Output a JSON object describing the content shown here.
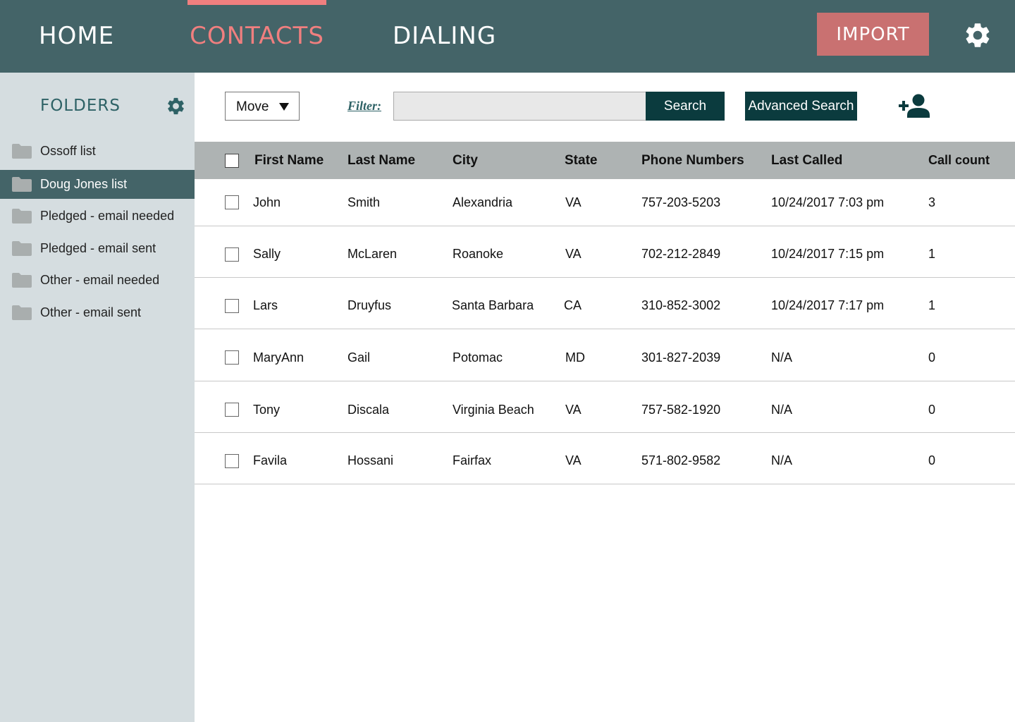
{
  "nav": {
    "tabs": [
      {
        "label": "HOME"
      },
      {
        "label": "CONTACTS"
      },
      {
        "label": "DIALING"
      }
    ],
    "active_tab": "CONTACTS",
    "import_label": "IMPORT",
    "accent_color": "#f07f7f",
    "bar_color": "#446468"
  },
  "sidebar": {
    "title": "FOLDERS",
    "folders": [
      {
        "label": "Ossoff list"
      },
      {
        "label": "Doug Jones list"
      },
      {
        "label": "Pledged - email needed"
      },
      {
        "label": "Pledged - email sent"
      },
      {
        "label": "Other - email needed"
      },
      {
        "label": "Other - email sent"
      }
    ],
    "selected_folder": "Doug Jones list"
  },
  "toolbar": {
    "move_label": "Move",
    "filter_label": "Filter:",
    "filter_value": "",
    "search_label": "Search",
    "advanced_search_label": "Advanced Search"
  },
  "table": {
    "columns": [
      "First Name",
      "Last Name",
      "City",
      "State",
      "Phone Numbers",
      "Last Called",
      "Call count"
    ],
    "rows": [
      {
        "first": "John",
        "last": "Smith",
        "city": "Alexandria",
        "state": "VA",
        "phone": "757-203-5203",
        "called": "10/24/2017 7:03 pm",
        "count": "3"
      },
      {
        "first": "Sally",
        "last": "McLaren",
        "city": "Roanoke",
        "state": "VA",
        "phone": "702-212-2849",
        "called": "10/24/2017 7:15 pm",
        "count": "1"
      },
      {
        "first": "Lars",
        "last": "Druyfus",
        "city": "Santa Barbara",
        "state": "CA",
        "phone": "310-852-3002",
        "called": "10/24/2017 7:17 pm",
        "count": "1"
      },
      {
        "first": "MaryAnn",
        "last": "Gail",
        "city": "Potomac",
        "state": "MD",
        "phone": "301-827-2039",
        "called": "N/A",
        "count": "0"
      },
      {
        "first": "Tony",
        "last": "Discala",
        "city": "Virginia Beach",
        "state": "VA",
        "phone": "757-582-1920",
        "called": "N/A",
        "count": "0"
      },
      {
        "first": "Favila",
        "last": "Hossani",
        "city": "Fairfax",
        "state": "VA",
        "phone": "571-802-9582",
        "called": "N/A",
        "count": "0"
      }
    ]
  },
  "icons": {
    "settings": "gear-icon",
    "folder_settings": "gear-icon",
    "folder": "folder-icon",
    "add_contact": "add-user-icon",
    "dropdown": "caret-down-icon"
  }
}
